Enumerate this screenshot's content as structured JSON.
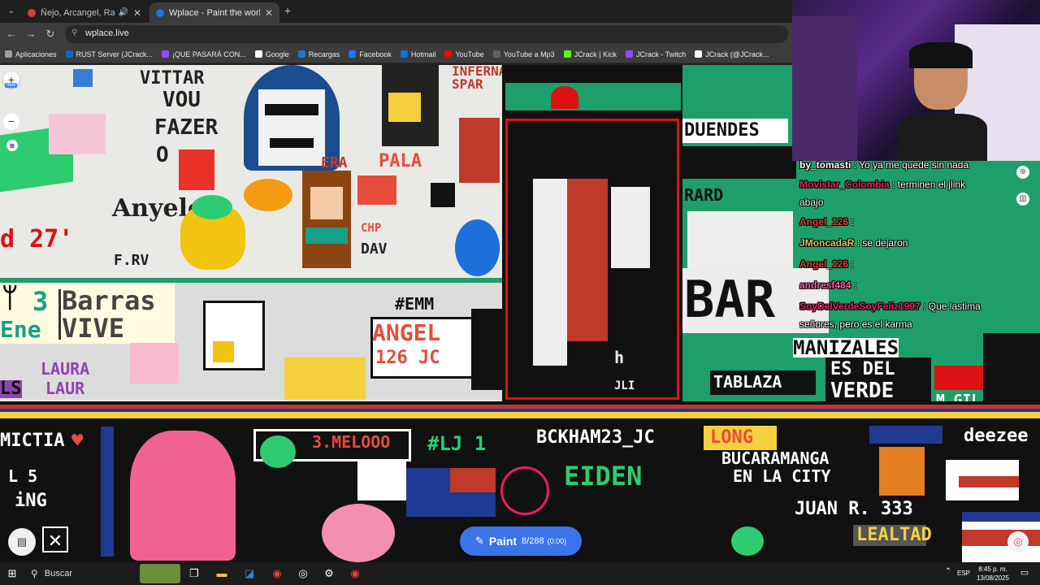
{
  "tabs": [
    {
      "label": "Ñejo, Arcangel, Rauw Alejandro",
      "active": false,
      "favicon_color": "#e53935"
    },
    {
      "label": "Wplace - Paint the world",
      "active": true,
      "favicon_color": "#1a73e8"
    }
  ],
  "address_bar": {
    "url": "wplace.live"
  },
  "bookmarks": [
    {
      "label": "Aplicaciones",
      "color": "#9e9e9e"
    },
    {
      "label": "RUST Server (JCrack...",
      "color": "#1565c0"
    },
    {
      "label": "¡QUE PASARÁ CON...",
      "color": "#9146ff"
    },
    {
      "label": "Google",
      "color": "#ffffff"
    },
    {
      "label": "Recargas",
      "color": "#1976d2"
    },
    {
      "label": "Facebook",
      "color": "#1877f2"
    },
    {
      "label": "Hotmail",
      "color": "#0078d4"
    },
    {
      "label": "YouTube",
      "color": "#ff0000"
    },
    {
      "label": "YouTube a Mp3",
      "color": "#616161"
    },
    {
      "label": "JCrack | Kick",
      "color": "#53fc18"
    },
    {
      "label": "JCrack - Twitch",
      "color": "#9146ff"
    },
    {
      "label": "JCrack (@JCrack...",
      "color": "#ffffff"
    }
  ],
  "canvas": {
    "art_text": [
      "VITTAR",
      "VOU",
      "FAZER",
      "O",
      "Anyelo",
      "d 27'",
      "F.RV",
      "3",
      "Barras",
      "VIVE",
      "Ene",
      "LAURA",
      "LAUR",
      "LS",
      "INFERNAL",
      "SPAR",
      "ERA",
      "PALA",
      "CHP",
      "DAV",
      "#EMM",
      "ANGEL",
      "126 JC",
      "DUENDES",
      "RARD",
      "BAR",
      "MANIZALES",
      "ES DEL",
      "VERDE",
      "TABLAZA",
      "M GIL",
      "MICTIA",
      "L 5",
      "iNG",
      "3.MELOOO",
      "#LJ 1",
      "BCKHAM23_JC",
      "LONG",
      "BUCARAMANGA",
      "EN LA CITY",
      "EIDEN",
      "JUAN R. 333",
      "LEALTAD",
      "deezee",
      "JLI",
      "h"
    ],
    "new_badge": "new"
  },
  "paint_button": {
    "label": "Paint",
    "count": "8/288",
    "timer": "(0:00)"
  },
  "chat": [
    {
      "user": "by_tomasti",
      "message": ": Yo ya me quede sin nada",
      "color": "#ffffff"
    },
    {
      "user": "Movistar_Colombia",
      "message": ": terminen el jlink",
      "color": "#e91e63"
    },
    {
      "user": "",
      "message": "abajo",
      "color": "#ffffff"
    },
    {
      "user": "Angel_126",
      "message": ":",
      "color": "#e53935"
    },
    {
      "user": "JMoncadaR",
      "message": ": se dejaron",
      "color": "#e0c060"
    },
    {
      "user": "Angel_126",
      "message": ":",
      "color": "#e53935"
    },
    {
      "user": "andresf484",
      "message": ":",
      "color": "#ff5ca8"
    },
    {
      "user": "SoyDelVerdeSoyFeliz1997",
      "message": ": Que lastima",
      "color": "#e91e63"
    },
    {
      "user": "",
      "message": "señores, pero es el karma",
      "color": "#ffffff"
    }
  ],
  "taskbar": {
    "search_label": "Buscar",
    "lang": "ESP",
    "time": "8:45 p. m.",
    "date": "13/08/2025"
  }
}
